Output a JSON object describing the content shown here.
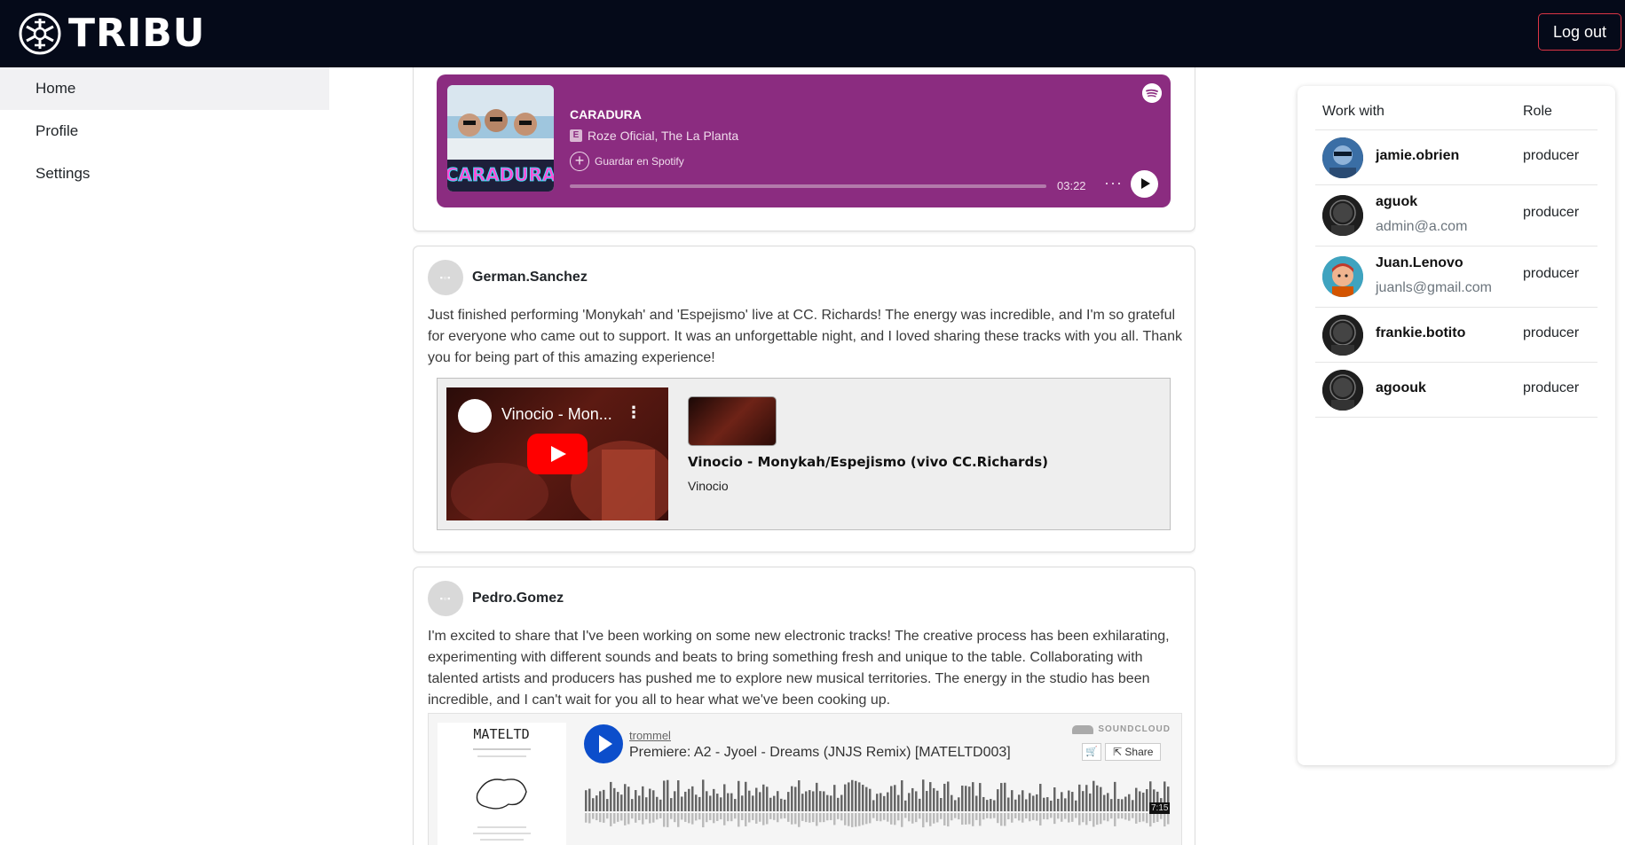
{
  "brand": {
    "name": "TRIBU"
  },
  "header": {
    "logout_label": "Log out"
  },
  "sidebar": {
    "items": [
      {
        "label": "Home",
        "active": true
      },
      {
        "label": "Profile",
        "active": false
      },
      {
        "label": "Settings",
        "active": false
      }
    ]
  },
  "feed": {
    "spotify": {
      "cover_text": "CARADURA",
      "title": "CARADURA",
      "explicit_badge": "E",
      "artists": "Roze Oficial, The La Planta",
      "save_label": "Guardar en Spotify",
      "time": "03:22",
      "more": "···"
    },
    "posts": [
      {
        "user": "German.Sanchez",
        "body": "Just finished performing 'Monykah' and 'Espejismo' live at CC. Richards! The energy was incredible, and I'm so grateful for everyone who came out to support. It was an unforgettable night, and I loved sharing these tracks with you all. Thank you for being part of this amazing experience!",
        "embed": {
          "player_title": "Vinocio - Mon...",
          "title": "Vinocio - Monykah/Espejismo (vivo CC.Richards)",
          "channel": "Vinocio"
        }
      },
      {
        "user": "Pedro.Gomez",
        "body": "I'm excited to share that I've been working on some new electronic tracks! The creative process has been exhilarating, experimenting with different sounds and beats to bring something fresh and unique to the table. Collaborating with talented artists and producers has pushed me to explore new musical territories. The energy in the studio has been incredible, and I can't wait for you all to hear what we've been cooking up.",
        "embed": {
          "cover_text": "MATELTD",
          "user": "trommel",
          "track": "Premiere: A2 - Jyoel - Dreams (JNJS Remix) [MATELTD003]",
          "brand": "SOUNDCLOUD",
          "share_label": "Share",
          "duration": "7:15"
        }
      }
    ]
  },
  "work_panel": {
    "col_work": "Work with",
    "col_role": "Role",
    "rows": [
      {
        "name": "jamie.obrien",
        "email": "",
        "role": "producer",
        "avatar": "blue"
      },
      {
        "name": "aguok",
        "email": "admin@a.com",
        "role": "producer",
        "avatar": "dark"
      },
      {
        "name": "Juan.Lenovo",
        "email": "juanls@gmail.com",
        "role": "producer",
        "avatar": "teal"
      },
      {
        "name": "frankie.botito",
        "email": "",
        "role": "producer",
        "avatar": "dark"
      },
      {
        "name": "agoouk",
        "email": "",
        "role": "producer",
        "avatar": "dark"
      }
    ]
  },
  "colors": {
    "topbar": "#050a19",
    "logout_border": "#dc3545",
    "spotify_bg": "#8b2c80",
    "youtube_red": "#ff0000",
    "soundcloud_blue": "#0c4ecb"
  }
}
